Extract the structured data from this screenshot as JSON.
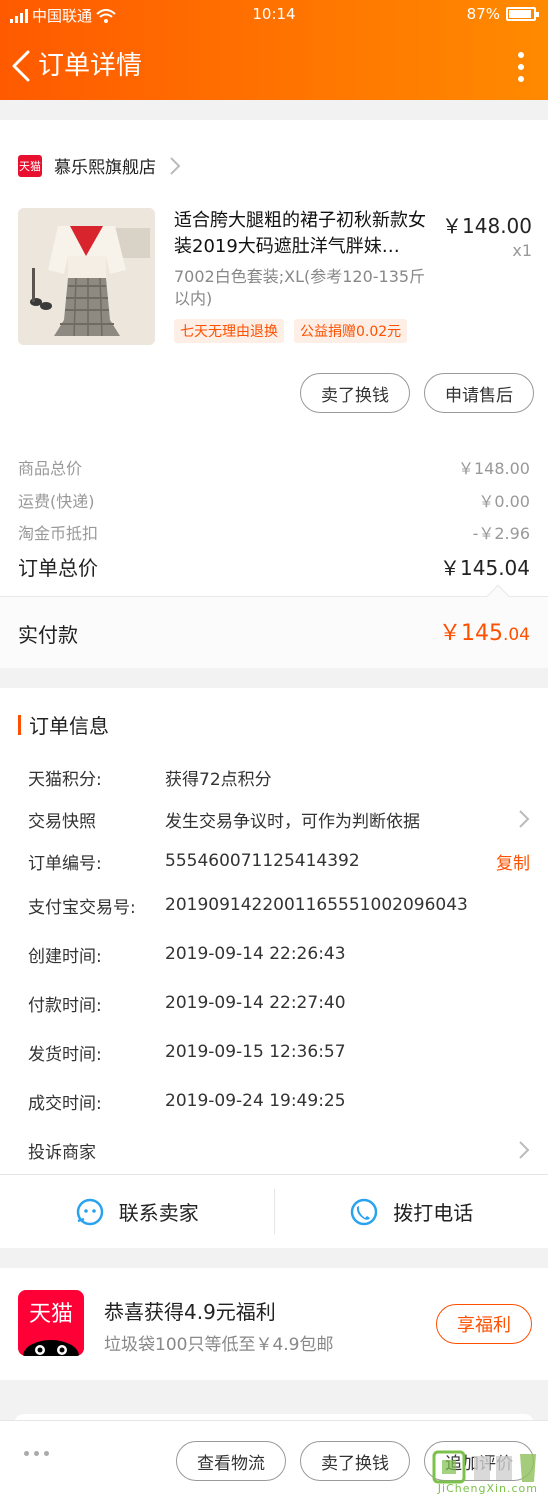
{
  "status_bar": {
    "carrier": "中国联通",
    "time": "10:14",
    "battery": "87%"
  },
  "header": {
    "title": "订单详情"
  },
  "store": {
    "badge": "天猫",
    "name": "慕乐熙旗舰店"
  },
  "product": {
    "title": "适合胯大腿粗的裙子初秋新款女装2019大码遮肚洋气胖妹…",
    "price": "￥148.00",
    "qty": "x1",
    "spec": "7002白色套装;XL(参考120-135斤以内)",
    "tags": [
      "七天无理由退换",
      "公益捐赠0.02元"
    ]
  },
  "product_actions": {
    "sell": "卖了换钱",
    "after_sale": "申请售后"
  },
  "fees": [
    {
      "label": "商品总价",
      "value": "￥148.00"
    },
    {
      "label": "运费(快递)",
      "value": "￥0.00"
    },
    {
      "label": "淘金币抵扣",
      "value": "-￥2.96"
    }
  ],
  "total": {
    "label": "订单总价",
    "value": "￥145.04"
  },
  "paid": {
    "label": "实付款",
    "yuan": "￥145",
    "cents": ".04"
  },
  "order_info": {
    "title": "订单信息",
    "rows": [
      {
        "key": "天猫积分:",
        "value": "获得72点积分"
      },
      {
        "key": "交易快照",
        "value": "发生交易争议时，可作为判断依据"
      },
      {
        "key": "订单编号:",
        "value": "555460071125414392",
        "action": "复制"
      },
      {
        "key": "支付宝交易号:",
        "value": "2019091422001165551002096043"
      },
      {
        "key": "创建时间:",
        "value": "2019-09-14 22:26:43"
      },
      {
        "key": "付款时间:",
        "value": "2019-09-14 22:27:40"
      },
      {
        "key": "发货时间:",
        "value": "2019-09-15 12:36:57"
      },
      {
        "key": "成交时间:",
        "value": "2019-09-24 19:49:25"
      },
      {
        "key": "投诉商家",
        "value": ""
      }
    ],
    "contact_seller": "联系卖家",
    "call_phone": "拨打电话"
  },
  "promo": {
    "logo": "天猫",
    "title": "恭喜获得4.9元福利",
    "subtitle": "垃圾袋100只等低至￥4.9包邮",
    "button": "享福利"
  },
  "bottom_bar": {
    "logistics": "查看物流",
    "sell": "卖了换钱",
    "review": "追加评价"
  },
  "watermark": {
    "text": "JiChengXin.com"
  },
  "colors": {
    "accent": "#ff5000",
    "header_start": "#ff5a00",
    "header_end": "#ff8a00"
  }
}
